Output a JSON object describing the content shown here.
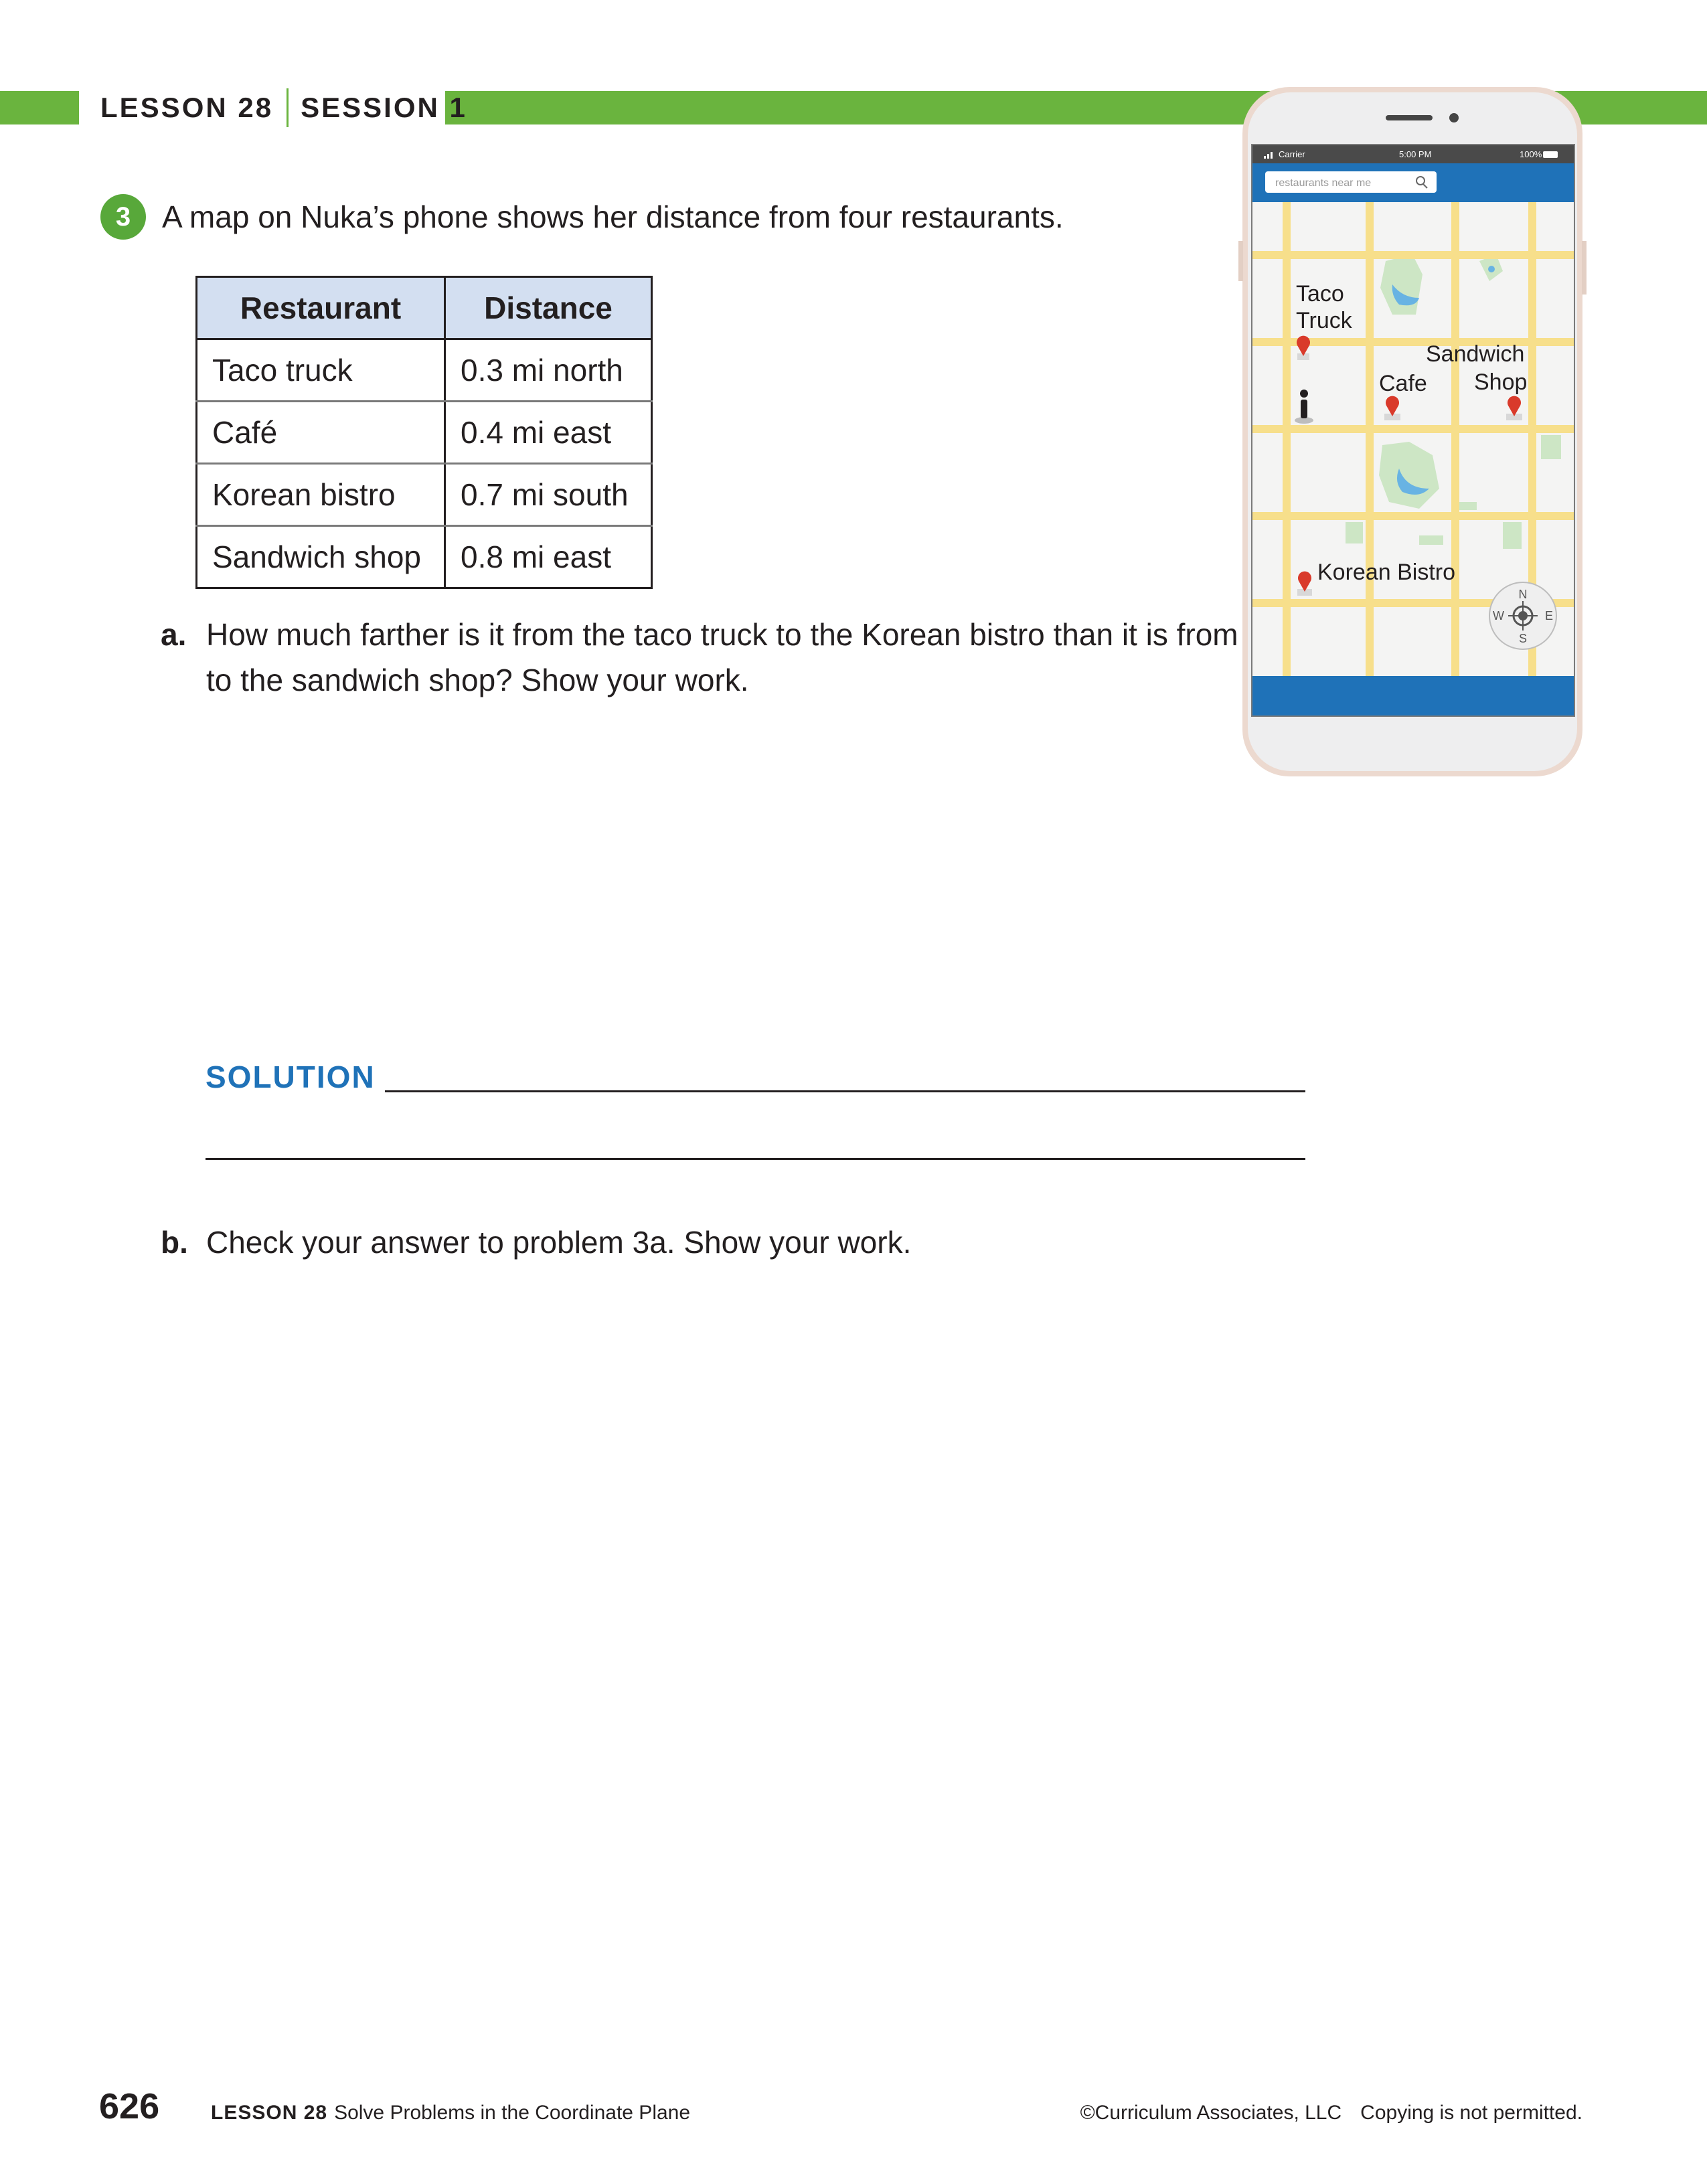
{
  "header": {
    "lesson": "LESSON 28",
    "session": "SESSION 1"
  },
  "question": {
    "number": "3",
    "prompt": "A map on Nuka’s phone shows her distance from four restaurants.",
    "table": {
      "headers": [
        "Restaurant",
        "Distance"
      ],
      "rows": [
        [
          "Taco truck",
          "0.3 mi north"
        ],
        [
          "Café",
          "0.4 mi east"
        ],
        [
          "Korean bistro",
          "0.7 mi south"
        ],
        [
          "Sandwich shop",
          "0.8 mi east"
        ]
      ]
    },
    "part_a": {
      "label": "a.",
      "text": "How much farther is it from the taco truck to the Korean bistro than it is from the café to the sandwich shop? Show your work."
    },
    "solution_label": "SOLUTION",
    "part_b": {
      "label": "b.",
      "text": "Check your answer to problem 3a. Show your work."
    }
  },
  "phone": {
    "status": {
      "carrier": "Carrier",
      "time": "5:00 PM",
      "battery": "100%"
    },
    "search_placeholder": "restaurants near me",
    "map_labels": {
      "taco_1": "Taco",
      "taco_2": "Truck",
      "sandwich_1": "Sandwich",
      "sandwich_2": "Shop",
      "cafe": "Cafe",
      "korean": "Korean Bistro",
      "compass_n": "N",
      "compass_s": "S",
      "compass_e": "E",
      "compass_w": "W"
    },
    "colors": {
      "road": "#f7df8b",
      "park": "#cde6c5",
      "water": "#68b3e3",
      "bar": "#1f72b8",
      "pin": "#d93a2b"
    }
  },
  "footer": {
    "page_number": "626",
    "lesson": "LESSON 28",
    "lesson_title": "Solve Problems in the Coordinate Plane",
    "copyright": "©Curriculum Associates, LLC",
    "notice": "Copying is not permitted."
  }
}
